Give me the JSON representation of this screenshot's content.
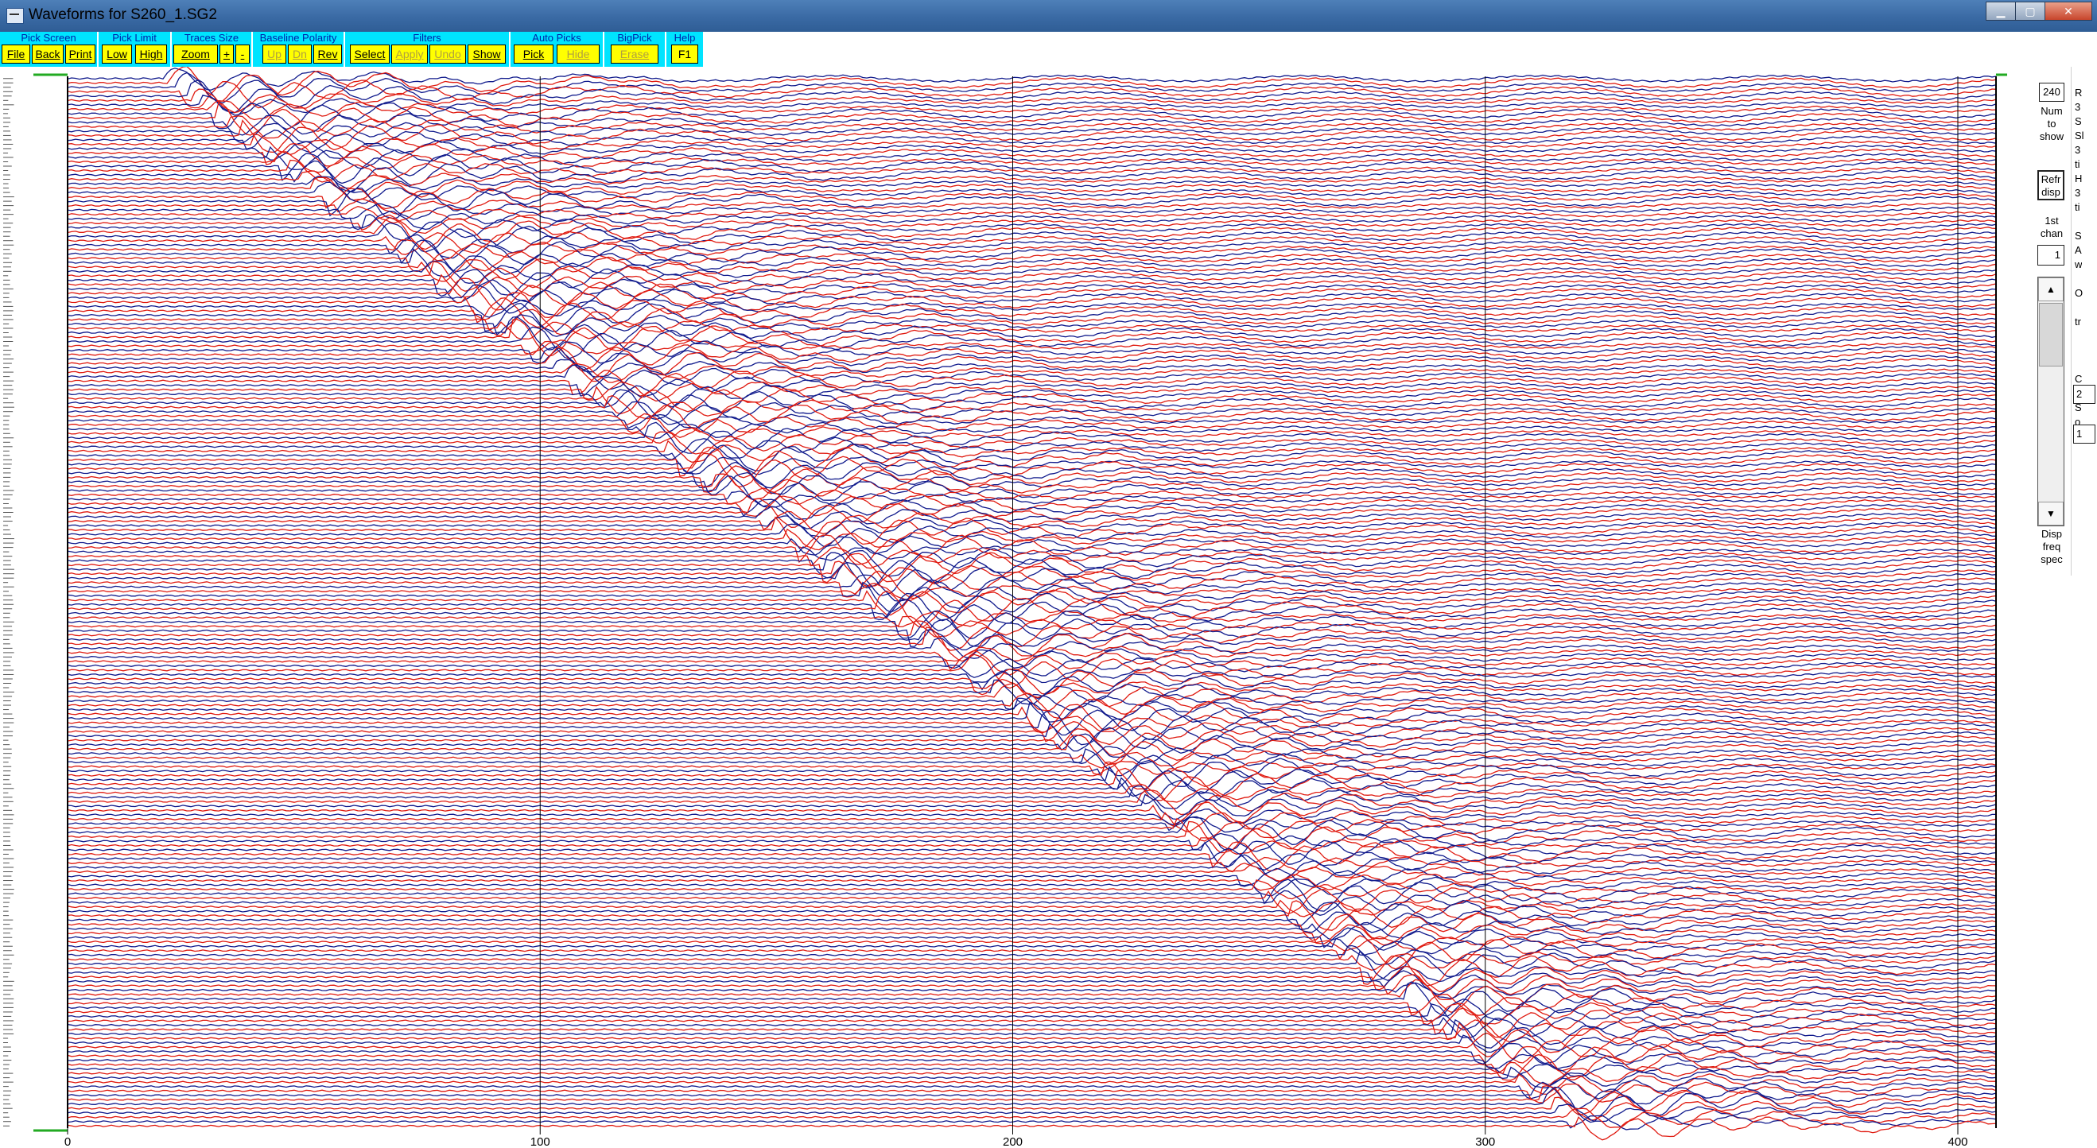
{
  "window": {
    "title": "Waveforms for S260_1.SG2",
    "min_label": "▁",
    "max_label": "▢",
    "close_label": "✕"
  },
  "toolbar": {
    "groups": [
      {
        "label": "Pick Screen",
        "buttons": [
          "File",
          "Back",
          "Print"
        ]
      },
      {
        "label": "Pick Limit",
        "buttons": [
          "Low",
          "High"
        ]
      },
      {
        "label": "Traces Size",
        "buttons": [
          "Zoom",
          "+",
          "-"
        ]
      },
      {
        "label": "Baseline Polarity",
        "buttons": [
          "Up",
          "Dn",
          "Rev"
        ]
      },
      {
        "label": "Filters",
        "buttons": [
          "Select",
          "Apply",
          "Undo",
          "Show"
        ]
      },
      {
        "label": "Auto Picks",
        "buttons": [
          "Pick",
          "Hide"
        ]
      },
      {
        "label": "BigPick",
        "buttons": [
          "Erase"
        ]
      },
      {
        "label": "Help",
        "buttons": [
          "F1"
        ]
      }
    ]
  },
  "plot": {
    "x_ticks": [
      "0",
      "100",
      "200",
      "300",
      "400"
    ],
    "colors": {
      "trace_a": "#101a8c",
      "trace_b": "#e01a10",
      "grid": "#000000",
      "axis_marker": "#22aa22"
    }
  },
  "right_panel": {
    "num_to_show_value": "240",
    "num_to_show_label": [
      "Num",
      "to",
      "show"
    ],
    "refr_button": [
      "Refr",
      "disp"
    ],
    "first_chan_label": [
      "1st",
      "chan"
    ],
    "first_chan_value": "1",
    "scroll_up": "▲",
    "scroll_down": "▼",
    "disp_freq_spec": [
      "Disp",
      "freq",
      "spec"
    ],
    "clipped_column": [
      "R",
      "3",
      "S",
      "Sl",
      "3",
      "ti",
      "H",
      "3",
      "ti",
      "",
      "S",
      "A",
      "w",
      "",
      "O",
      "",
      "tr",
      "",
      "",
      "",
      "C",
      "",
      "S",
      "o"
    ],
    "clipped_input_1": "2",
    "clipped_input_2": "1"
  }
}
